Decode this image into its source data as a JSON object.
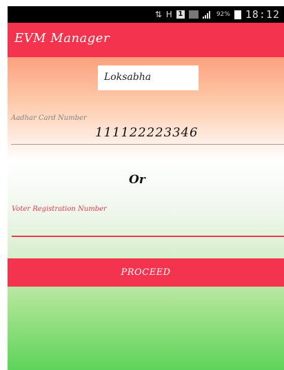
{
  "status_bar": {
    "battery_percent": "92%",
    "time": "18:12",
    "sim_badge": "1",
    "icons": [
      "notification-icon",
      "network-h-icon",
      "sim-1-icon",
      "sim-2-icon",
      "signal-icon",
      "battery-icon"
    ]
  },
  "app_bar": {
    "title": "EVM Manager"
  },
  "form": {
    "house_selector": "Loksabha",
    "aadhar": {
      "label": "Aadhar Card Number",
      "value": "111122223346"
    },
    "or_text": "Or",
    "voter": {
      "label": "Voter Registration Number",
      "value": ""
    },
    "proceed_label": "PROCEED"
  },
  "colors": {
    "accent": "#f4344f",
    "saffron": "#fca07e",
    "green": "#5dd45a"
  }
}
